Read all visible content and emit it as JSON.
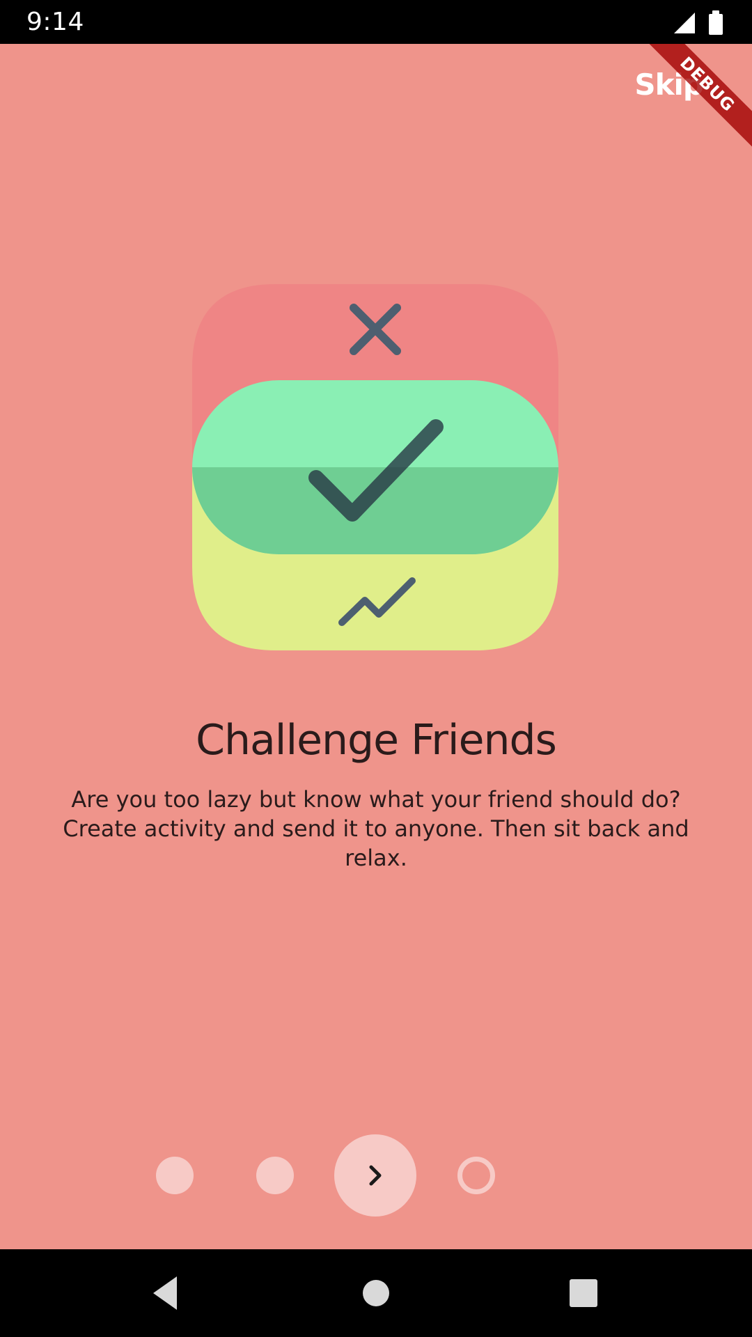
{
  "status_bar": {
    "time": "9:14",
    "icons": [
      "signal-icon",
      "battery-icon"
    ]
  },
  "debug_banner": "DEBUG",
  "header": {
    "skip_label": "Skip"
  },
  "illustration": {
    "icons": [
      "close-icon",
      "checkmark-icon",
      "trend-line-icon"
    ],
    "colors": {
      "red_card": "#ef8585",
      "green_card": "#8aefb4",
      "green_overlap": "#6fce93",
      "yellow_card": "#e0ee8a",
      "icon_dark": "#4d5f70"
    }
  },
  "content": {
    "title": "Challenge Friends",
    "description": "Are you too lazy but know what your friend should do? Create activity and send it to anyone. Then sit back and relax."
  },
  "pager": {
    "page_count": 4,
    "next_icon": "chevron-right-icon"
  },
  "nav_bar": {
    "icons": [
      "back-icon",
      "home-icon",
      "recents-icon"
    ]
  },
  "colors": {
    "background": "#ef948b",
    "indicator": "#f7cac6",
    "text": "#2a1b1b"
  }
}
